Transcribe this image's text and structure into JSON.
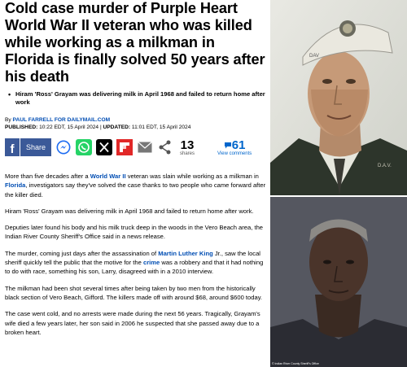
{
  "headline": "Cold case murder of Purple Heart World War II veteran who was killed while working as a milkman in Florida is finally solved 50 years after his death",
  "bullets": [
    "Hiram 'Ross' Grayam was delivering milk in April 1968 and failed to return home after work"
  ],
  "byline": {
    "by": "By",
    "author": "PAUL FARRELL FOR DAILYMAIL.COM",
    "published_label": "PUBLISHED:",
    "published": "10:22 EDT, 15 April 2024",
    "sep": "|",
    "updated_label": "UPDATED:",
    "updated": "11:01 EDT, 15 April 2024"
  },
  "share": {
    "fb_letter": "f",
    "share_label": "Share",
    "shares_count": "13",
    "shares_label": "shares",
    "comments_count": "61",
    "comments_label": "View comments",
    "icons": [
      "messenger-icon",
      "whatsapp-icon",
      "x-icon",
      "flipboard-icon",
      "email-icon",
      "share-icon"
    ]
  },
  "paragraphs": [
    [
      "More than five decades after a ",
      {
        "link": "World War II"
      },
      " veteran was slain while working as a milkman in ",
      {
        "link": "Florida"
      },
      ", investigators say they've solved the case thanks to two people who came forward after the killer died."
    ],
    [
      "Hiram 'Ross' Grayam was delivering milk in April 1968 and failed to return home after work."
    ],
    [
      "Deputies later found his body and his milk truck deep in the woods in the Vero Beach area, the Indian River County Sheriff's Office said in a news release."
    ],
    [
      "The murder, coming just days after the assassination of ",
      {
        "link": "Martin Luther King"
      },
      " Jr., saw the local sheriff quickly tell the public that the motive for the ",
      {
        "link": "crime"
      },
      " was a robbery and that it had nothing to do with race, something his son, Larry, disagreed with in a 2010 interview."
    ],
    [
      "The milkman had been shot several times after being taken by two men from the historically black section of Vero Beach, Gifford. The killers made off with around $68, around $600 today."
    ],
    [
      "The case went cold, and no arrests were made during the next 56 years. Tragically, Grayam's wife died a few years later, her son said in 2006 he suspected that she passed away due to a broken heart."
    ]
  ],
  "photos": {
    "top_cap_text": "DAV",
    "top_collar_text": "D.A.V.",
    "bottom_credit": "© Indian River County Sheriff's Office"
  },
  "colors": {
    "link": "#004db3",
    "facebook": "#3b5998",
    "comments": "#0066cc"
  }
}
